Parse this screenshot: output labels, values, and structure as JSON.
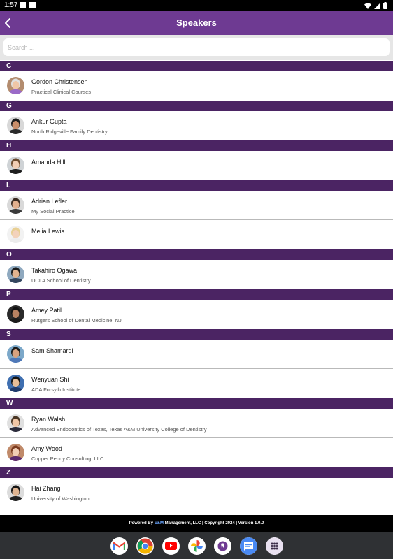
{
  "status_bar": {
    "time": "1:57"
  },
  "app_bar": {
    "title": "Speakers"
  },
  "search": {
    "placeholder": "Search ..."
  },
  "sections": [
    {
      "letter": "C",
      "speakers": [
        {
          "name": "Gordon Christensen",
          "subtitle": "Practical Clinical Courses",
          "hair": "#e0e0e0",
          "skin": "#f0c6a6",
          "shirt": "#9a6ac8",
          "bg": "#b38c6e"
        }
      ]
    },
    {
      "letter": "G",
      "speakers": [
        {
          "name": "Ankur Gupta",
          "subtitle": "North Ridgeville Family Dentistry",
          "hair": "#1c1c1c",
          "skin": "#c98e6a",
          "shirt": "#2a2a2a",
          "bg": "#d8d8d8"
        }
      ]
    },
    {
      "letter": "H",
      "speakers": [
        {
          "name": "Amanda Hill",
          "subtitle": "",
          "hair": "#6b4a2e",
          "skin": "#f1cdb4",
          "shirt": "#1e1e1e",
          "bg": "#cfd3d6"
        }
      ]
    },
    {
      "letter": "L",
      "speakers": [
        {
          "name": "Adrian Lefler",
          "subtitle": "My Social Practice",
          "hair": "#3a2a20",
          "skin": "#e2b08e",
          "shirt": "#3a3a3a",
          "bg": "#d9d9d9"
        },
        {
          "name": "Melia Lewis",
          "subtitle": "",
          "hair": "#e8cf93",
          "skin": "#f3d2bb",
          "shirt": "#ececec",
          "bg": "#f2f2f2"
        }
      ]
    },
    {
      "letter": "O",
      "speakers": [
        {
          "name": "Takahiro Ogawa",
          "subtitle": "UCLA School of Dentistry",
          "hair": "#1a1a1a",
          "skin": "#e1b38f",
          "shirt": "#34465e",
          "bg": "#8fa9bf"
        }
      ]
    },
    {
      "letter": "P",
      "speakers": [
        {
          "name": "Amey Patil",
          "subtitle": "Rutgers School of Dental Medicine, NJ",
          "hair": "#121212",
          "skin": "#b88262",
          "shirt": "#1c1c1c",
          "bg": "#2a2a2a"
        }
      ]
    },
    {
      "letter": "S",
      "speakers": [
        {
          "name": "Sam Shamardi",
          "subtitle": "",
          "hair": "#1c1c1c",
          "skin": "#d9a27f",
          "shirt": "#4f78b8",
          "bg": "#7ca8c9"
        },
        {
          "name": "Wenyuan Shi",
          "subtitle": "ADA Forsyth Institute",
          "hair": "#141414",
          "skin": "#e6bd98",
          "shirt": "#1f3a6b",
          "bg": "#3f6fb0"
        }
      ]
    },
    {
      "letter": "W",
      "speakers": [
        {
          "name": "Ryan Walsh",
          "subtitle": "Advanced Endodontics of Texas, Texas A&M University College of Dentistry",
          "hair": "#4a3624",
          "skin": "#f0c6a6",
          "shirt": "#2b2b3a",
          "bg": "#e0e0e0"
        },
        {
          "name": "Amy Wood",
          "subtitle": "Copper Penny Consulting, LLC",
          "hair": "#7a3a1e",
          "skin": "#f1cdb4",
          "shirt": "#5b2a6e",
          "bg": "#c08a6a"
        }
      ]
    },
    {
      "letter": "Z",
      "speakers": [
        {
          "name": "Hai Zhang",
          "subtitle": "University of Washington",
          "hair": "#161616",
          "skin": "#e0b592",
          "shirt": "#222222",
          "bg": "#dcdcdc"
        }
      ]
    }
  ],
  "footer": {
    "prefix": "Powered By ",
    "brand": "E&M",
    "suffix": " Management, LLC | Copyright 2024 | Version 1.0.0"
  },
  "dock": [
    {
      "name": "gmail",
      "icon": "gmail-icon"
    },
    {
      "name": "chrome",
      "icon": "chrome-icon"
    },
    {
      "name": "youtube",
      "icon": "youtube-icon"
    },
    {
      "name": "photos",
      "icon": "photos-icon"
    },
    {
      "name": "app",
      "icon": "tooth-app-icon"
    },
    {
      "name": "messages",
      "icon": "messages-icon"
    },
    {
      "name": "app-drawer",
      "icon": "app-drawer-icon"
    }
  ]
}
